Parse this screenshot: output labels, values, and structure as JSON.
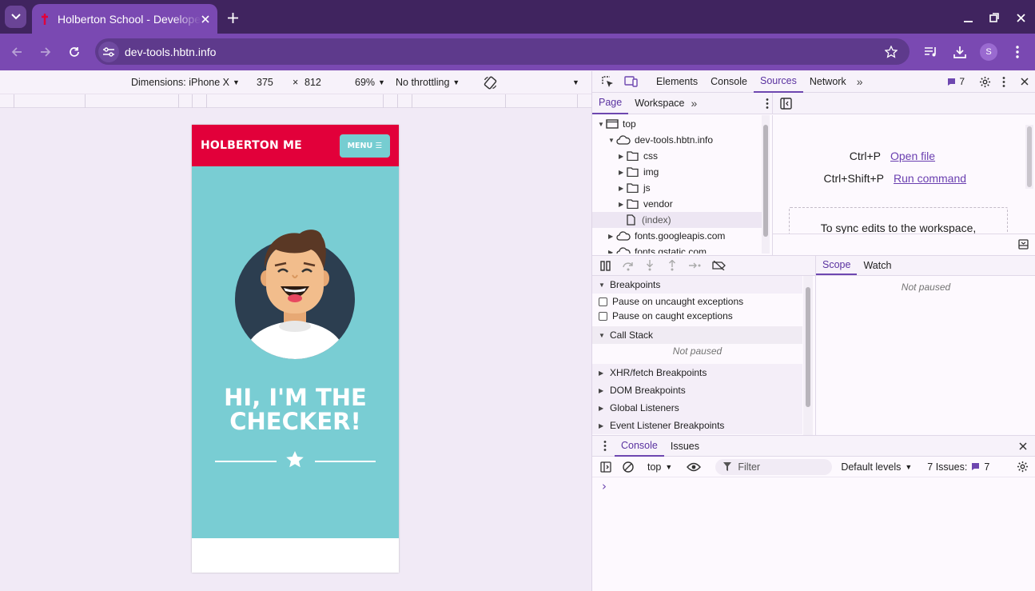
{
  "browser": {
    "tab_title": "Holberton School - Developer tools",
    "url": "dev-tools.hbtn.info",
    "profile_initial": "S"
  },
  "device_toolbar": {
    "dimensions_label": "Dimensions: iPhone X",
    "width": "375",
    "times": "×",
    "height": "812",
    "zoom": "69%",
    "throttling": "No throttling"
  },
  "site": {
    "logo": "HOLBERTON ME",
    "menu_label": "MENU ☰",
    "hero_title_line1": "HI, I'M THE",
    "hero_title_line2": "CHECKER!"
  },
  "devtools": {
    "tabs": [
      "Elements",
      "Console",
      "Sources",
      "Network"
    ],
    "active_tab": "Sources",
    "issues_count": "7",
    "sources_tabs": [
      "Page",
      "Workspace"
    ],
    "tree": {
      "top": "top",
      "domain": "dev-tools.hbtn.info",
      "folders": [
        "css",
        "img",
        "js",
        "vendor"
      ],
      "index": "(index)",
      "fonts1": "fonts.googleapis.com",
      "fonts2": "fonts.gstatic.com"
    },
    "shortcuts": {
      "open_key": "Ctrl+P",
      "open_label": "Open file",
      "run_key": "Ctrl+Shift+P",
      "run_label": "Run command"
    },
    "workspace_hint": "To sync edits to the workspace,",
    "debugger": {
      "breakpoints": "Breakpoints",
      "pause_uncaught": "Pause on uncaught exceptions",
      "pause_caught": "Pause on caught exceptions",
      "call_stack": "Call Stack",
      "not_paused": "Not paused",
      "xhr": "XHR/fetch Breakpoints",
      "dom": "DOM Breakpoints",
      "global": "Global Listeners",
      "event": "Event Listener Breakpoints"
    },
    "scope_tabs": [
      "Scope",
      "Watch"
    ],
    "scope_not_paused": "Not paused",
    "drawer": {
      "tabs": [
        "Console",
        "Issues"
      ],
      "context": "top",
      "filter_placeholder": "Filter",
      "levels": "Default levels",
      "issues_label": "7 Issues:",
      "issues_count": "7",
      "prompt": "›"
    }
  },
  "colors": {
    "tab_strip": "#40245f",
    "toolbar": "#7a49b2",
    "site_header": "#e2003a",
    "hero_bg": "#79cdd3",
    "devtools_accent": "#6e47b0"
  }
}
